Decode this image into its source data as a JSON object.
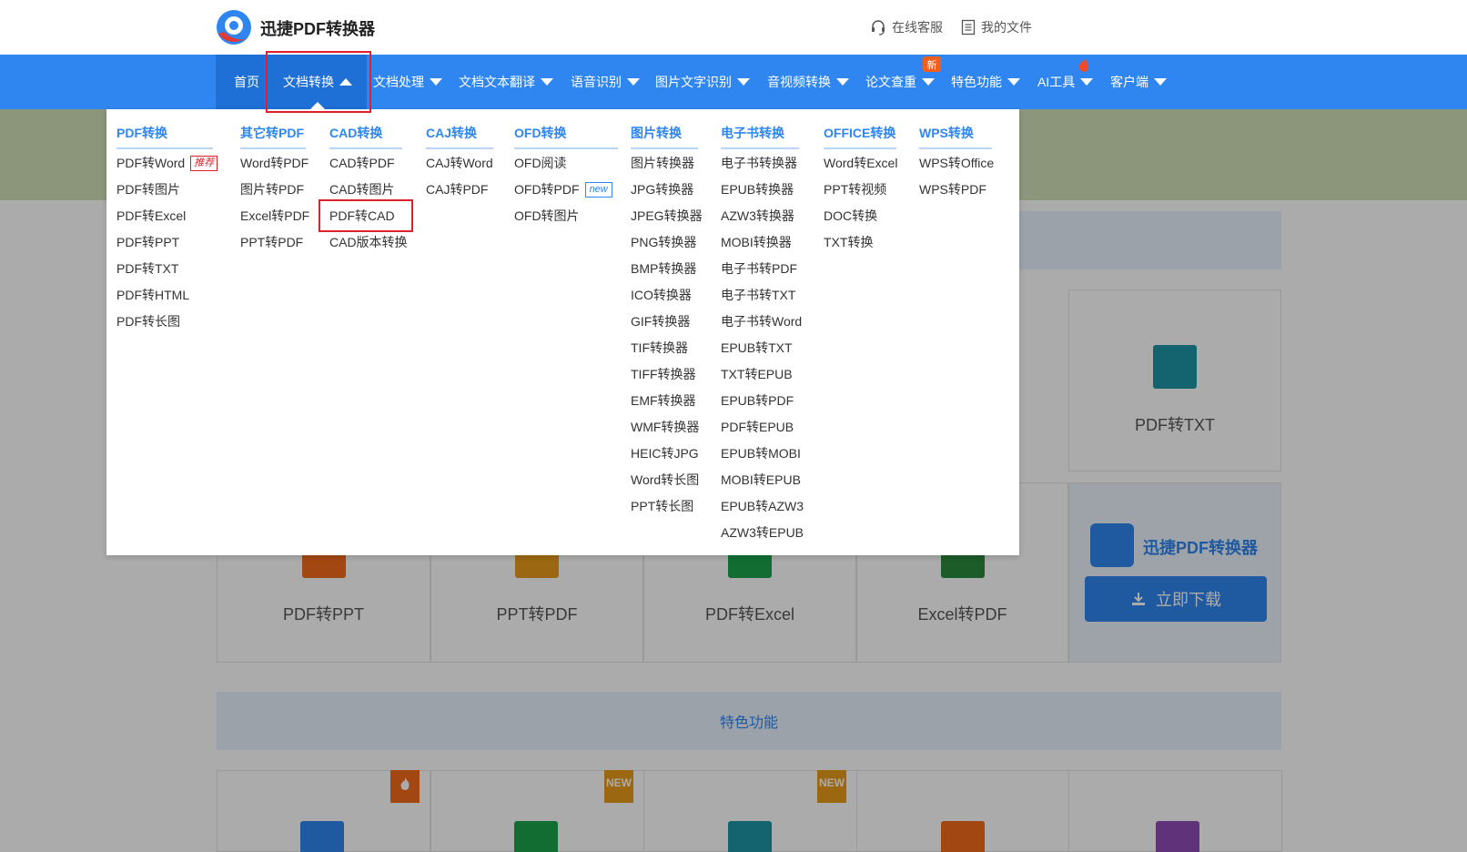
{
  "header": {
    "brand": "迅捷PDF转换器",
    "links": [
      {
        "label": "在线客服",
        "icon": "headset-icon"
      },
      {
        "label": "我的文件",
        "icon": "file-list-icon"
      }
    ]
  },
  "nav": {
    "items": [
      "首页",
      "文档转换",
      "文档处理",
      "文档文本翻译",
      "语音识别",
      "图片文字识别",
      "音视频转换",
      "论文查重",
      "特色功能",
      "AI工具",
      "客户端"
    ],
    "new_badge": "新",
    "active": "文档转换",
    "accent_color": "#2f86f0"
  },
  "dropdown": {
    "columns": [
      {
        "title": "PDF转换",
        "items": [
          "PDF转Word",
          "PDF转图片",
          "PDF转Excel",
          "PDF转PPT",
          "PDF转TXT",
          "PDF转HTML",
          "PDF转长图"
        ],
        "tag_first": "推荐"
      },
      {
        "title": "其它转PDF",
        "items": [
          "Word转PDF",
          "图片转PDF",
          "Excel转PDF",
          "PPT转PDF"
        ]
      },
      {
        "title": "CAD转换",
        "items": [
          "CAD转PDF",
          "CAD转图片",
          "PDF转CAD",
          "CAD版本转换"
        ]
      },
      {
        "title": "CAJ转换",
        "items": [
          "CAJ转Word",
          "CAJ转PDF"
        ]
      },
      {
        "title": "OFD转换",
        "items": [
          "OFD阅读",
          "OFD转PDF",
          "OFD转图片"
        ],
        "tag_second": "new"
      },
      {
        "title": "图片转换",
        "items": [
          "图片转换器",
          "JPG转换器",
          "JPEG转换器",
          "PNG转换器",
          "BMP转换器",
          "ICO转换器",
          "GIF转换器",
          "TIF转换器",
          "TIFF转换器",
          "EMF转换器",
          "WMF转换器",
          "HEIC转JPG",
          "Word转长图",
          "PPT转长图"
        ]
      },
      {
        "title": "电子书转换",
        "items": [
          "电子书转换器",
          "EPUB转换器",
          "AZW3转换器",
          "MOBI转换器",
          "电子书转PDF",
          "电子书转TXT",
          "电子书转Word",
          "EPUB转TXT",
          "TXT转EPUB",
          "EPUB转PDF",
          "PDF转EPUB",
          "EPUB转MOBI",
          "MOBI转EPUB",
          "EPUB转AZW3",
          "AZW3转EPUB"
        ]
      },
      {
        "title": "OFFICE转换",
        "items": [
          "Word转Excel",
          "PPT转视频",
          "DOC转换",
          "TXT转换"
        ]
      },
      {
        "title": "WPS转换",
        "items": [
          "WPS转Office",
          "WPS转PDF"
        ]
      }
    ]
  },
  "background": {
    "cards_row": [
      "PDF转PPT",
      "PPT转PDF",
      "PDF转Excel",
      "Excel转PDF"
    ],
    "card_txt": "PDF转TXT",
    "promo_title": "迅捷PDF转换器",
    "promo_button": "立即下载",
    "section_title": "特色功能",
    "badges": [
      "NEW",
      "NEW"
    ]
  }
}
